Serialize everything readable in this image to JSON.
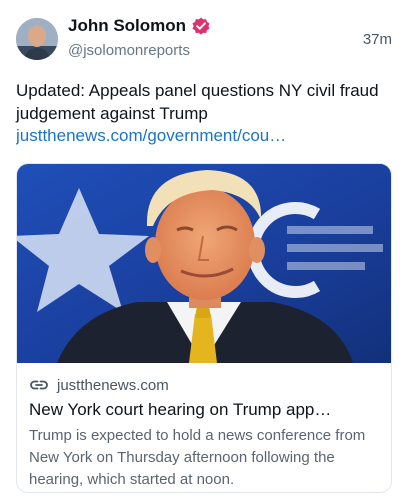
{
  "author": {
    "display_name": "John Solomon",
    "handle": "@jsolomonreports",
    "verified": true,
    "avatar_icon": "person-avatar"
  },
  "timestamp": "37m",
  "post": {
    "text": "Updated: Appeals panel questions NY civil fraud judgement against Trump",
    "link": "justthenews.com/government/cou…"
  },
  "card": {
    "image_icon": "photo-of-man-in-suit",
    "domain": "justthenews.com",
    "title": "New York court hearing on Trump app…",
    "description": "Trump is expected to hold a news conference from New York on Thursday afternoon following the hearing, which started at noon."
  },
  "colors": {
    "link": "#1d72c9",
    "verified": "#e0306e",
    "secondary_text": "#657786",
    "card_border": "#e3e6ea"
  }
}
